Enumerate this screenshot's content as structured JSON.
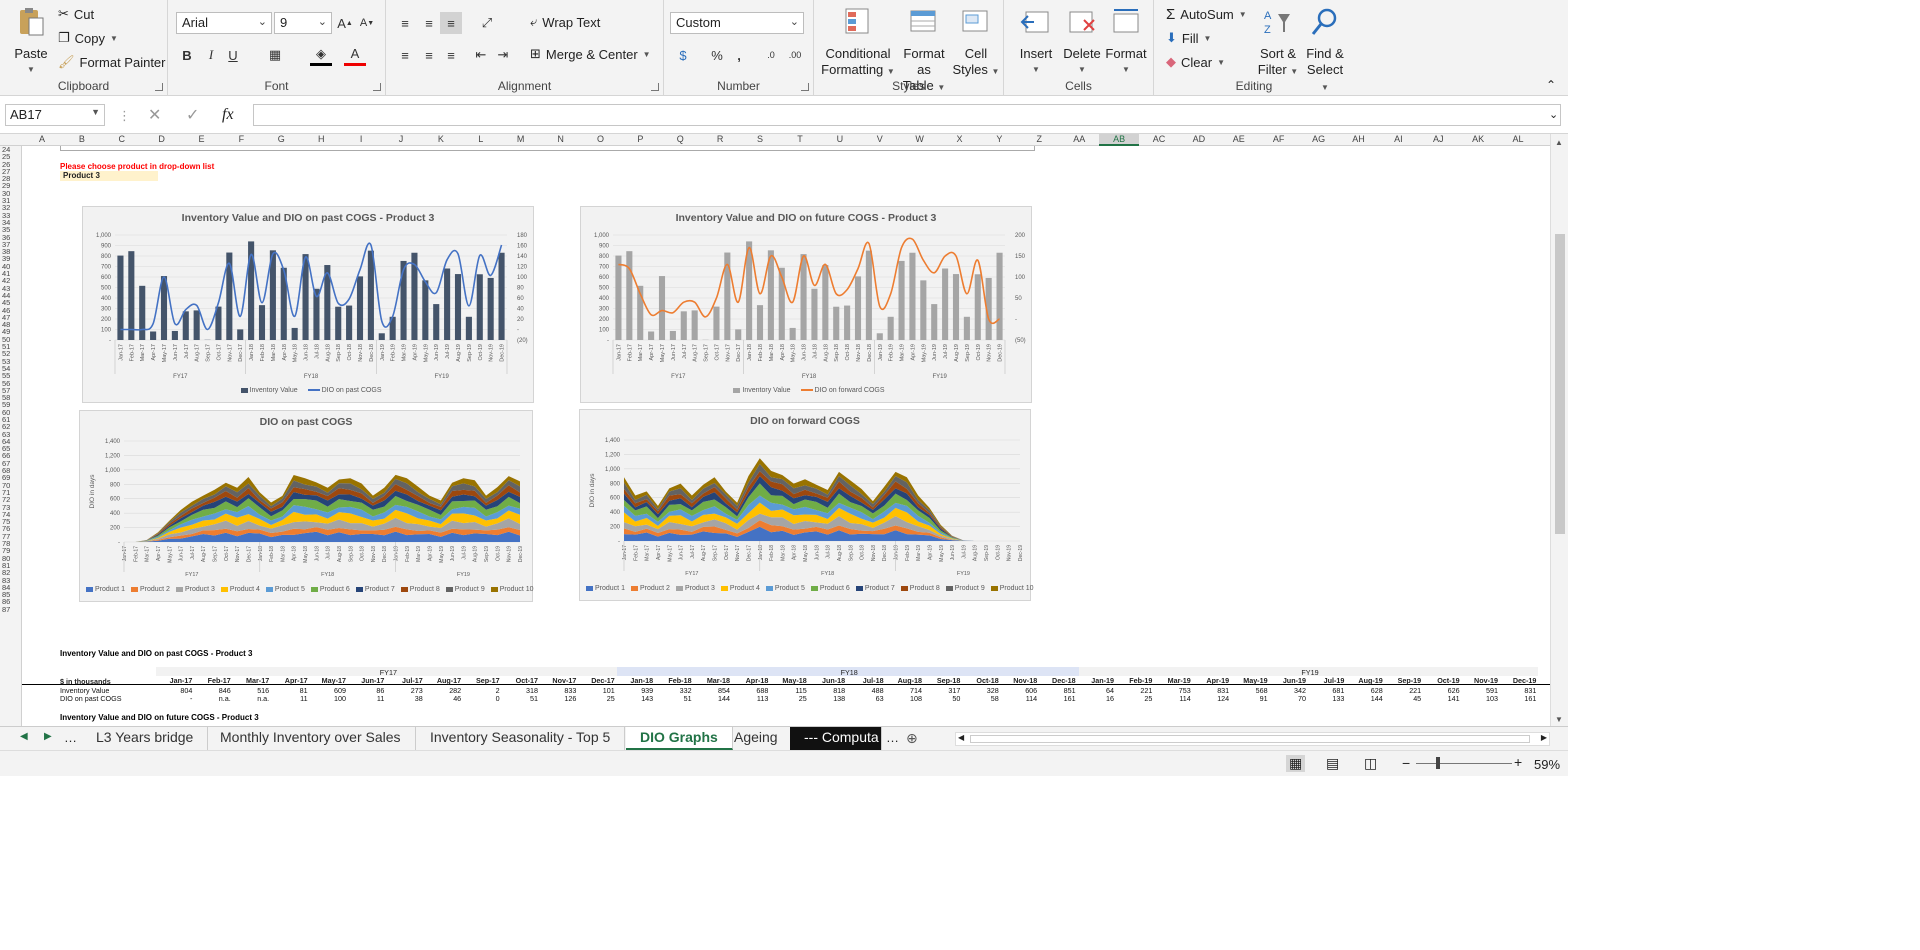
{
  "ribbon": {
    "clipboard": {
      "paste": "Paste",
      "cut": "Cut",
      "copy": "Copy",
      "format_painter": "Format Painter",
      "label": "Clipboard"
    },
    "font": {
      "name": "Arial",
      "size": "9",
      "label": "Font",
      "bold": "B",
      "italic": "I",
      "underline": "U"
    },
    "alignment": {
      "wrap_text": "Wrap Text",
      "merge_center": "Merge & Center",
      "label": "Alignment"
    },
    "number": {
      "format": "Custom",
      "label": "Number",
      "percent": "%",
      "comma": ","
    },
    "styles": {
      "conditional": "Conditional",
      "conditional2": "Formatting",
      "format_as": "Format as",
      "format_as2": "Table",
      "cell": "Cell",
      "cell2": "Styles",
      "label": "Styles"
    },
    "cells": {
      "insert": "Insert",
      "delete": "Delete",
      "format": "Format",
      "label": "Cells"
    },
    "editing": {
      "autosum": "AutoSum",
      "fill": "Fill",
      "clear": "Clear",
      "sort": "Sort &",
      "sort2": "Filter",
      "find": "Find &",
      "find2": "Select",
      "label": "Editing"
    }
  },
  "formula_bar": {
    "name_box": "AB17",
    "formula": "",
    "fx": "fx"
  },
  "columns": [
    "A",
    "B",
    "C",
    "D",
    "E",
    "F",
    "G",
    "H",
    "I",
    "J",
    "K",
    "L",
    "M",
    "N",
    "O",
    "P",
    "Q",
    "R",
    "S",
    "T",
    "U",
    "V",
    "W",
    "X",
    "Y",
    "Z",
    "AA",
    "AB",
    "AC",
    "AD",
    "AE",
    "AF",
    "AG",
    "AH",
    "AI",
    "AJ",
    "AK",
    "AL"
  ],
  "rows": [
    "24",
    "25",
    "26",
    "27",
    "28",
    "29",
    "30",
    "31",
    "32",
    "33",
    "34",
    "35",
    "36",
    "37",
    "38",
    "39",
    "40",
    "41",
    "42",
    "43",
    "44",
    "45",
    "46",
    "47",
    "48",
    "49",
    "50",
    "51",
    "52",
    "53",
    "54",
    "55",
    "56",
    "57",
    "58",
    "59",
    "60",
    "61",
    "62",
    "63",
    "64",
    "65",
    "66",
    "67",
    "68",
    "69",
    "70",
    "71",
    "72",
    "73",
    "74",
    "75",
    "76",
    "77",
    "78",
    "79",
    "80",
    "81",
    "82",
    "83",
    "84",
    "85",
    "86",
    "87"
  ],
  "sheet": {
    "prompt": "Please choose product in drop-down list",
    "selected_product": "Product 3",
    "colors": {
      "inventory_dark": "#44546a",
      "dio_blue": "#4472c4",
      "inventory_gray": "#a5a5a5",
      "dio_orange": "#ed7d31",
      "prompt_red": "#ff0000",
      "selected_fill": "#fff2cc"
    }
  },
  "chart_data": [
    {
      "type": "bar",
      "title": "Inventory Value and DIO on past COGS - Product 3",
      "categories": [
        "Jan-17",
        "Feb-17",
        "Mar-17",
        "Apr-17",
        "May-17",
        "Jun-17",
        "Jul-17",
        "Aug-17",
        "Sep-17",
        "Oct-17",
        "Nov-17",
        "Dec-17",
        "Jan-18",
        "Feb-18",
        "Mar-18",
        "Apr-18",
        "May-18",
        "Jun-18",
        "Jul-18",
        "Aug-18",
        "Sep-18",
        "Oct-18",
        "Nov-18",
        "Dec-18",
        "Jan-19",
        "Feb-19",
        "Mar-19",
        "Apr-19",
        "May-19",
        "Jun-19",
        "Jul-19",
        "Aug-19",
        "Sep-19",
        "Oct-19",
        "Nov-19",
        "Dec-19"
      ],
      "groups": [
        "FY17",
        "FY18",
        "FY19"
      ],
      "series": [
        {
          "name": "Inventory Value",
          "type": "bar",
          "axis": "left",
          "values": [
            804,
            846,
            516,
            81,
            609,
            86,
            273,
            282,
            2,
            318,
            833,
            101,
            939,
            332,
            854,
            688,
            115,
            818,
            488,
            714,
            317,
            328,
            606,
            851,
            64,
            221,
            753,
            831,
            568,
            342,
            681,
            628,
            221,
            626,
            591,
            831
          ]
        },
        {
          "name": "DIO on past COGS",
          "type": "line",
          "axis": "right",
          "values": [
            0,
            0,
            0,
            11,
            100,
            11,
            38,
            46,
            0,
            51,
            126,
            25,
            143,
            51,
            144,
            113,
            25,
            138,
            63,
            108,
            50,
            58,
            114,
            161,
            16,
            25,
            114,
            124,
            91,
            70,
            133,
            144,
            45,
            141,
            103,
            161
          ]
        }
      ],
      "ylim_left": [
        0,
        1000
      ],
      "yticks_left": [
        "-",
        "100",
        "200",
        "300",
        "400",
        "500",
        "600",
        "700",
        "800",
        "900",
        "1,000"
      ],
      "ylim_right": [
        -20,
        180
      ],
      "yticks_right": [
        "(20)",
        "-",
        "20",
        "40",
        "60",
        "80",
        "100",
        "120",
        "140",
        "160",
        "180"
      ],
      "legend": "bottom"
    },
    {
      "type": "bar",
      "title": "Inventory Value and DIO on future COGS - Product 3",
      "categories": [
        "Jan-17",
        "Feb-17",
        "Mar-17",
        "Apr-17",
        "May-17",
        "Jun-17",
        "Jul-17",
        "Aug-17",
        "Sep-17",
        "Oct-17",
        "Nov-17",
        "Dec-17",
        "Jan-18",
        "Feb-18",
        "Mar-18",
        "Apr-18",
        "May-18",
        "Jun-18",
        "Jul-18",
        "Aug-18",
        "Sep-18",
        "Oct-18",
        "Nov-18",
        "Dec-18",
        "Jan-19",
        "Feb-19",
        "Mar-19",
        "Apr-19",
        "May-19",
        "Jun-19",
        "Jul-19",
        "Aug-19",
        "Sep-19",
        "Oct-19",
        "Nov-19",
        "Dec-19"
      ],
      "groups": [
        "FY17",
        "FY18",
        "FY19"
      ],
      "series": [
        {
          "name": "Inventory Value",
          "type": "bar",
          "axis": "left",
          "values": [
            804,
            846,
            516,
            81,
            609,
            86,
            273,
            282,
            2,
            318,
            833,
            101,
            939,
            332,
            854,
            688,
            115,
            818,
            488,
            714,
            317,
            328,
            606,
            851,
            64,
            221,
            753,
            831,
            568,
            342,
            681,
            628,
            221,
            626,
            591,
            831
          ]
        },
        {
          "name": "DIO on forward COGS",
          "type": "line",
          "axis": "right",
          "values": [
            130,
            120,
            60,
            10,
            20,
            15,
            40,
            40,
            5,
            50,
            130,
            40,
            170,
            60,
            150,
            100,
            40,
            150,
            80,
            130,
            60,
            70,
            120,
            180,
            30,
            60,
            170,
            190,
            140,
            110,
            150,
            150,
            60,
            140,
            0,
            0
          ]
        }
      ],
      "ylim_left": [
        0,
        1000
      ],
      "yticks_left": [
        "-",
        "100",
        "200",
        "300",
        "400",
        "500",
        "600",
        "700",
        "800",
        "900",
        "1,000"
      ],
      "ylim_right": [
        -50,
        200
      ],
      "yticks_right": [
        "(50)",
        "-",
        "50",
        "100",
        "150",
        "200"
      ],
      "legend": "bottom"
    },
    {
      "type": "area",
      "title": "DIO on past COGS",
      "ylabel": "DIO in days",
      "ylim": [
        0,
        1400
      ],
      "yticks": [
        "-",
        "200",
        "400",
        "600",
        "800",
        "1,000",
        "1,200",
        "1,400"
      ],
      "groups": [
        "FY17",
        "FY18",
        "FY19"
      ],
      "series_names": [
        "Product 1",
        "Product 2",
        "Product 3",
        "Product 4",
        "Product 5",
        "Product 6",
        "Product 7",
        "Product 8",
        "Product 9",
        "Product 10"
      ],
      "totals": [
        0,
        0,
        30,
        150,
        320,
        500,
        620,
        700,
        820,
        900,
        850,
        1000,
        750,
        620,
        700,
        1050,
        980,
        900,
        850,
        950,
        1000,
        900,
        700,
        850,
        1020,
        1000,
        850,
        700,
        650,
        900,
        1000,
        950,
        700,
        860,
        1000,
        950
      ],
      "legend": "bottom"
    },
    {
      "type": "area",
      "title": "DIO on forward COGS",
      "ylabel": "DIO in days",
      "ylim": [
        0,
        1400
      ],
      "yticks": [
        "-",
        "200",
        "400",
        "600",
        "800",
        "1,000",
        "1,200",
        "1,400"
      ],
      "groups": [
        "FY17",
        "FY18",
        "FY19"
      ],
      "series_names": [
        "Product 1",
        "Product 2",
        "Product 3",
        "Product 4",
        "Product 5",
        "Product 6",
        "Product 7",
        "Product 8",
        "Product 9",
        "Product 10"
      ],
      "totals": [
        1000,
        700,
        750,
        550,
        800,
        900,
        700,
        850,
        1000,
        750,
        600,
        1000,
        1250,
        1100,
        1000,
        900,
        950,
        850,
        800,
        1050,
        950,
        800,
        600,
        850,
        1050,
        1000,
        700,
        500,
        250,
        80,
        10,
        0,
        0,
        0,
        0,
        0
      ],
      "legend": "bottom"
    }
  ],
  "table1": {
    "title": "Inventory Value and DIO on past COGS - Product 3",
    "header_label": "$ in thousands",
    "years": [
      "FY17",
      "FY18",
      "FY19"
    ],
    "months": [
      "Jan-17",
      "Feb-17",
      "Mar-17",
      "Apr-17",
      "May-17",
      "Jun-17",
      "Jul-17",
      "Aug-17",
      "Sep-17",
      "Oct-17",
      "Nov-17",
      "Dec-17",
      "Jan-18",
      "Feb-18",
      "Mar-18",
      "Apr-18",
      "May-18",
      "Jun-18",
      "Jul-18",
      "Aug-18",
      "Sep-18",
      "Oct-18",
      "Nov-18",
      "Dec-18",
      "Jan-19",
      "Feb-19",
      "Mar-19",
      "Apr-19",
      "May-19",
      "Jun-19",
      "Jul-19",
      "Aug-19",
      "Sep-19",
      "Oct-19",
      "Nov-19",
      "Dec-19"
    ],
    "rows": [
      {
        "label": "Inventory Value",
        "values": [
          "804",
          "846",
          "516",
          "81",
          "609",
          "86",
          "273",
          "282",
          "2",
          "318",
          "833",
          "101",
          "939",
          "332",
          "854",
          "688",
          "115",
          "818",
          "488",
          "714",
          "317",
          "328",
          "606",
          "851",
          "64",
          "221",
          "753",
          "831",
          "568",
          "342",
          "681",
          "628",
          "221",
          "626",
          "591",
          "831"
        ]
      },
      {
        "label": "DIO on past COGS",
        "values": [
          "-",
          "n.a.",
          "n.a.",
          "11",
          "100",
          "11",
          "38",
          "46",
          "0",
          "51",
          "126",
          "25",
          "143",
          "51",
          "144",
          "113",
          "25",
          "138",
          "63",
          "108",
          "50",
          "58",
          "114",
          "161",
          "16",
          "25",
          "114",
          "124",
          "91",
          "70",
          "133",
          "144",
          "45",
          "141",
          "103",
          "161"
        ]
      }
    ]
  },
  "table2_title": "Inventory Value and DIO on future COGS - Product 3",
  "tabs": [
    "L3 Years bridge",
    "Monthly Inventory over Sales",
    "Inventory Seasonality - Top 5",
    "DIO Graphs",
    "Ageing",
    "--- Computa"
  ],
  "active_tab": "DIO Graphs",
  "status": {
    "zoom": "59%"
  }
}
